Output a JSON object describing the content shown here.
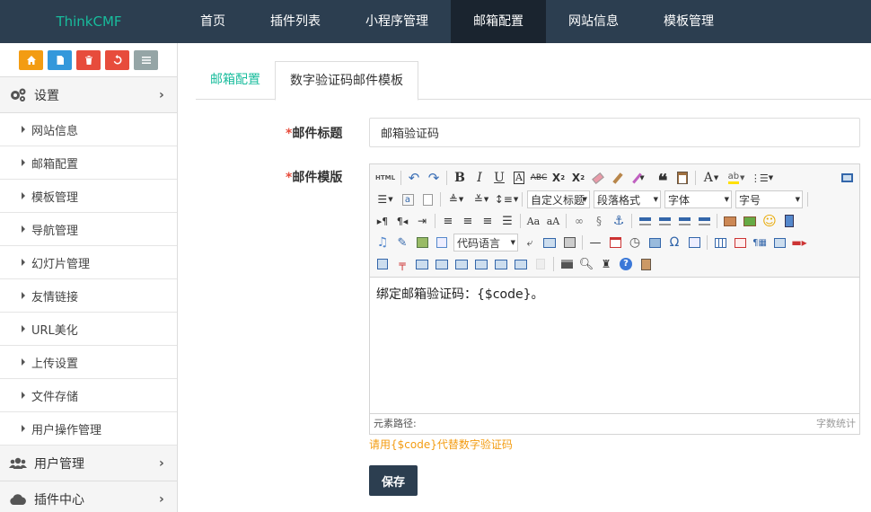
{
  "brand": "ThinkCMF",
  "nav": [
    "首页",
    "插件列表",
    "小程序管理",
    "邮箱配置",
    "网站信息",
    "模板管理"
  ],
  "nav_active": 3,
  "shortcuts": [
    {
      "icon": "home-icon",
      "color": "#f39c12"
    },
    {
      "icon": "file-icon",
      "color": "#3498db"
    },
    {
      "icon": "trash-icon",
      "color": "#e74c3c"
    },
    {
      "icon": "recycle-icon",
      "color": "#e74c3c"
    },
    {
      "icon": "list-icon",
      "color": "#95a5a6"
    }
  ],
  "sidebar": {
    "settings": {
      "label": "设置",
      "icon": "gears-icon"
    },
    "items": [
      "网站信息",
      "邮箱配置",
      "模板管理",
      "导航管理",
      "幻灯片管理",
      "友情链接",
      "URL美化",
      "上传设置",
      "文件存储",
      "用户操作管理"
    ],
    "users": {
      "label": "用户管理",
      "icon": "users-icon"
    },
    "plugins": {
      "label": "插件中心",
      "icon": "cloud-icon"
    }
  },
  "tabs": [
    "邮箱配置",
    "数字验证码邮件模板"
  ],
  "tab_active": 1,
  "form": {
    "title_required": "*",
    "title_label": "邮件标题",
    "title_value": "邮箱验证码",
    "template_required": "*",
    "template_label": "邮件模版",
    "editor_content": "绑定邮箱验证码：{$code}。",
    "path_label": "元素路径:",
    "word_count": "字数统计",
    "hint": "请用{$code}代替数字验证码",
    "save": "保存"
  },
  "editor_selects": {
    "custom_title": "自定义标题",
    "paragraph": "段落格式",
    "font": "字体",
    "size": "字号",
    "code_lang": "代码语言"
  }
}
